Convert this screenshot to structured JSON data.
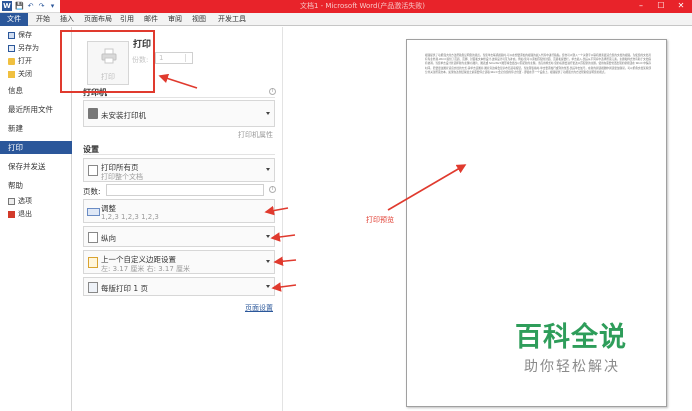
{
  "window": {
    "title": "文档1 - Microsoft Word(产品激活失败)",
    "logo": "W",
    "quick_access": [
      "💾",
      "↶",
      "↷",
      "▾"
    ],
    "controls": {
      "minimize": "–",
      "maximize": "☐",
      "close": "✕"
    }
  },
  "ribbon": {
    "tabs": [
      "文件",
      "开始",
      "插入",
      "页面布局",
      "引用",
      "邮件",
      "审阅",
      "视图",
      "开发工具"
    ]
  },
  "nav": {
    "items": [
      {
        "label": "保存",
        "icon": "save-icon"
      },
      {
        "label": "另存为",
        "icon": "save-as-icon"
      },
      {
        "label": "打开",
        "icon": "open-folder-icon"
      },
      {
        "label": "关闭",
        "icon": "close-file-icon"
      },
      {
        "label": "信息"
      },
      {
        "label": "最近所用文件"
      },
      {
        "label": "新建"
      },
      {
        "label": "打印",
        "active": true
      },
      {
        "label": "保存并发送"
      },
      {
        "label": "帮助"
      },
      {
        "label": "选项",
        "icon": "options-icon"
      },
      {
        "label": "退出",
        "icon": "exit-icon"
      }
    ]
  },
  "print": {
    "title": "打印",
    "button_label": "打印",
    "copies_label": "份数:",
    "copies_value": "1",
    "printer_section": "打印机",
    "printer_name": "未安装打印机",
    "printer_properties": "打印机属性",
    "settings_section": "设置",
    "range_main": "打印所有页",
    "range_sub": "打印整个文档",
    "pages_label": "页数:",
    "collate_main": "调整",
    "collate_sub": "1,2,3    1,2,3    1,2,3",
    "orientation": "纵向",
    "margins_main": "上一个自定义边距设置",
    "margins_sub": "左: 3.17 厘米    右: 3.17 厘米",
    "pages_per_sheet": "每版打印 1 页",
    "page_setup": "页面设置",
    "info_glyph": "i"
  },
  "preview": {
    "label": "打印预览",
    "page_text": "视频提供了功能强大的方法帮助您证明您的观点。当您单击联机视频时,可以在想要添加的视频的嵌入代码中进行粘贴。您也可以键入一个关键字以联机搜索最适合您的文档的视频。为使您的文档具有专业外观,Word 提供了页眉、页脚、封面和文本框设计,这些设计可互为补充。例如,您可以添加匹配的封面、页眉和提要栏。单击插入,然后从不同库中选择所需元素。主题和样式也有助于文档保持协调。当您单击设计并选择新的主题时,图片、图表或 SmartArt 图形将会更改以匹配新的主题。当应用样式时,您的标题会进行更改以匹配新的主题。使用在需要位置出现的新按钮在 Word 中保存时间。若要更改图片适应文档的方式,请单击该图片,图片旁边将会显示布局选项按钮。当处理表格时,单击要添加行或列的位置,然后单击加号。在新的阅读视图中阅读更加容易。可以折叠文档某些部分并关注所需文本。如果在达到结尾处之前需要停止读取,Word 会记住您的停止位置 - 即使在另一个设备上。视频提供了功能强大的方法帮助您证明您的观点。"
  },
  "watermark": {
    "line1": "百科全说",
    "line2": "助你轻松解决"
  },
  "colors": {
    "accent": "#2b579a",
    "title_bar": "#e8232a",
    "annotation": "#e03a2e",
    "watermark": "#2e9d5a"
  }
}
